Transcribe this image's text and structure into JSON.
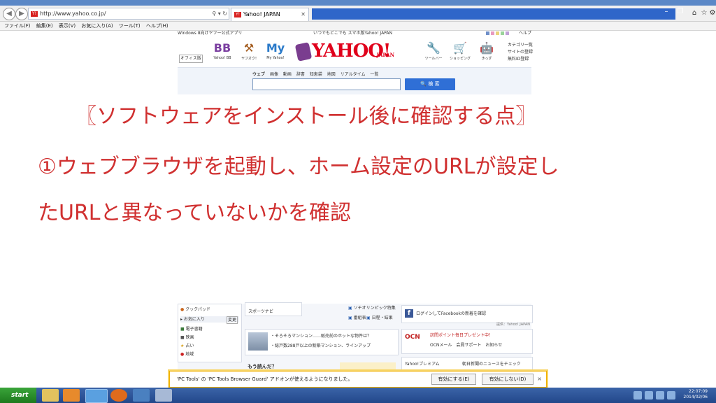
{
  "browser": {
    "url": "http://www.yahoo.co.jp/",
    "tab_title": "Yahoo! JAPAN",
    "favicon_text": "Y!",
    "menu": [
      "ファイル(F)",
      "編集(E)",
      "表示(V)",
      "お気に入り(A)",
      "ツール(T)",
      "ヘルプ(H)"
    ]
  },
  "page": {
    "topline_left": "Windows 8向けヤフー公式アプリ",
    "topline_mid": "いつでもどこでも スマホ版Yahoo! JAPAN",
    "topline_help": "ヘルプ",
    "office_label": "オフィス版",
    "services": [
      {
        "icon": "BB",
        "label": "Yahoo! BB"
      },
      {
        "icon": "⚒",
        "label": "ヤフオク!"
      },
      {
        "icon": "My",
        "label": "My Yahoo!"
      },
      {
        "icon": "🔧",
        "label": "ツールバー"
      },
      {
        "icon": "🛒",
        "label": "ショッピング"
      },
      {
        "icon": "🤖",
        "label": "きっず"
      }
    ],
    "logo_text": "YAHOO!",
    "logo_sub": "JAPAN",
    "side_links": [
      "カテゴリ一覧",
      "サイトの登録",
      "無料ID登録"
    ],
    "search_tabs": [
      "ウェブ",
      "画像",
      "動画",
      "辞書",
      "知恵袋",
      "地図",
      "リアルタイム",
      "一覧"
    ],
    "search_button": "🔍 検 索"
  },
  "annotation": {
    "line1": "〖ソフトウェアをインストール後に確認する点〗",
    "line2": "①ウェブブラウザを起動し、ホーム設定のURLが設定し",
    "line3": "たURLと異なっていないかを確認"
  },
  "lower": {
    "left_items": [
      "クックパッド",
      "お気に入り",
      "電子書籍",
      "映画",
      "占い",
      "地域"
    ],
    "edit_label": "変更",
    "sports": "スポーツナビ",
    "olympic": "ソチオリンピック特集",
    "tv": "番組表",
    "schedule": "日程・結果",
    "facebook": "ログインしてFacebookの新着を確認",
    "facebook_note": "提供：Yahoo! JAPAN",
    "news1": "・そろそろマンション……販売前のホットな物件は？",
    "news2": "・総戸数288戸以上の新築マンション、ラインアップ",
    "ocn_name": "OCN",
    "ocn_line1": "訪問ポイント毎日プレゼント中！",
    "ocn_line2": "OCNメール　会員サポート　お知らせ",
    "premium": "Yahoo!プレミアム",
    "premium_text": "朝日新聞のニュースをチェック",
    "read_more": "もう読んだ？"
  },
  "notification": {
    "text": "'PC Tools' の 'PC Tools Browser Guard' アドオンが使えるようになりました。",
    "enable": "有効にする(E)",
    "disable": "有効にしない(D)",
    "close": "×"
  },
  "taskbar": {
    "start": "start",
    "time": "22:07:09",
    "date": "2014/02/06"
  }
}
